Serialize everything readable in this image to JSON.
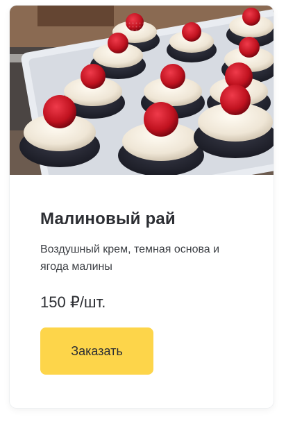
{
  "product": {
    "image_alt": "cupcakes-with-raspberries",
    "title": "Малиновый рай",
    "description": "Воздушный крем, темная основа и ягода малины",
    "price": "150 ₽/шт.",
    "order_label": "Заказать"
  },
  "colors": {
    "button": "#fdd54a",
    "text": "#2c2e33",
    "card_border": "#eef0f2"
  }
}
